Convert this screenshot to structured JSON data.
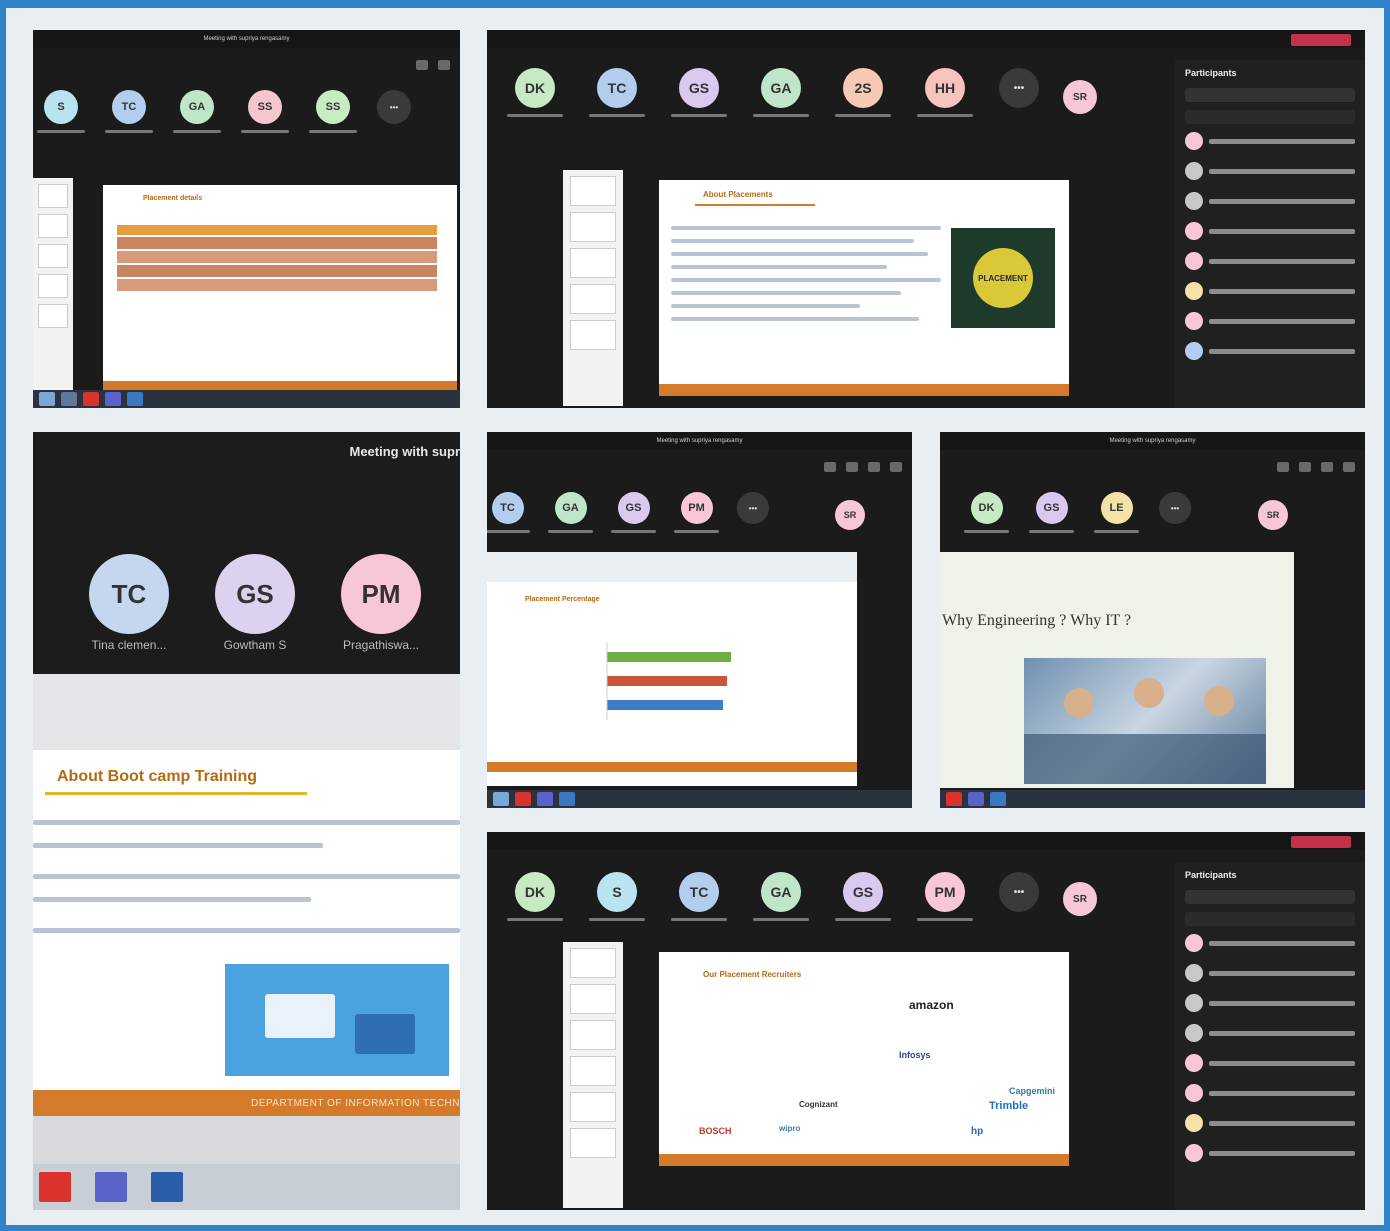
{
  "panels": {
    "p1": {
      "title": "Meeting with supriya rengasamy",
      "avatars": [
        {
          "initials": "S",
          "color": "#b8e3ef"
        },
        {
          "initials": "TC",
          "color": "#b3cdef"
        },
        {
          "initials": "GA",
          "color": "#bfe6c8"
        },
        {
          "initials": "SS",
          "color": "#f4c6d0"
        },
        {
          "initials": "SS",
          "color": "#c8ecc2"
        }
      ],
      "slide_title": "Placement details"
    },
    "p2": {
      "avatars": [
        {
          "initials": "DK",
          "color": "#c7e9c4"
        },
        {
          "initials": "TC",
          "color": "#b3cdef"
        },
        {
          "initials": "GS",
          "color": "#d9c9ef"
        },
        {
          "initials": "GA",
          "color": "#bfe6c8"
        },
        {
          "initials": "2S",
          "color": "#f6c9b4"
        },
        {
          "initials": "HH",
          "color": "#f6c4bd"
        }
      ],
      "sr_initials": "SR",
      "slide_title": "About Placements",
      "image_label": "PLACEMENT",
      "participants_title": "Participants"
    },
    "p3": {
      "title": "Meeting with supr",
      "avatars": [
        {
          "initials": "TC",
          "name": "Tina clemen...",
          "color": "#c5d6ef"
        },
        {
          "initials": "GS",
          "name": "Gowtham S",
          "color": "#dcd2f0"
        },
        {
          "initials": "PM",
          "name": "Pragathiswa...",
          "color": "#f7c6d7"
        }
      ],
      "slide_title": "About Boot camp Training",
      "footer_text": "DEPARTMENT OF INFORMATION TECHN"
    },
    "p4": {
      "title": "Meeting with supriya rengasamy",
      "avatars": [
        {
          "initials": "TC",
          "color": "#b3cdef"
        },
        {
          "initials": "GA",
          "color": "#bfe6c8"
        },
        {
          "initials": "GS",
          "color": "#d9c9ef"
        },
        {
          "initials": "PM",
          "color": "#f7c6d7"
        }
      ],
      "sr_initials": "SR",
      "slide_title": "Placement Percentage"
    },
    "p5": {
      "title": "Meeting with supriya rengasamy",
      "avatars": [
        {
          "initials": "DK",
          "color": "#c7e9c4"
        },
        {
          "initials": "GS",
          "color": "#d9c9ef"
        },
        {
          "initials": "LE",
          "color": "#f3e3a6"
        }
      ],
      "sr_initials": "SR",
      "slide_heading": "Why Engineering ? Why IT ?"
    },
    "p6": {
      "avatars": [
        {
          "initials": "DK",
          "color": "#c7e9c4"
        },
        {
          "initials": "S",
          "color": "#b8e3ef"
        },
        {
          "initials": "TC",
          "color": "#b3cdef"
        },
        {
          "initials": "GA",
          "color": "#bfe6c8"
        },
        {
          "initials": "GS",
          "color": "#d9c9ef"
        },
        {
          "initials": "PM",
          "color": "#f7c6d7"
        }
      ],
      "sr_initials": "SR",
      "slide_title": "Our Placement Recruiters",
      "participants_title": "Participants",
      "recruiters": [
        "amazon",
        "Infosys",
        "Capgemini",
        "Trimble",
        "BOSCH",
        "wipro",
        "hp",
        "Cognizant"
      ]
    }
  }
}
